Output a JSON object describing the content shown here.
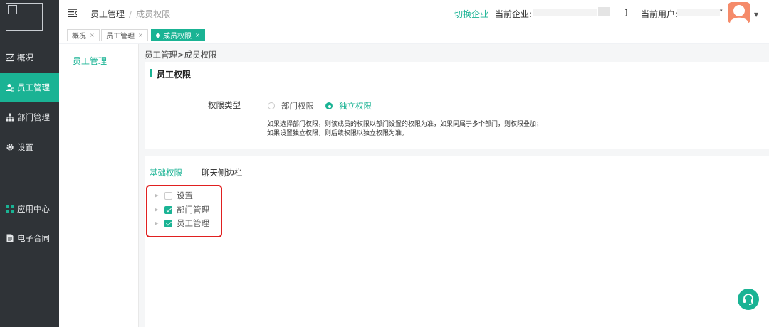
{
  "sidebar": {
    "items": [
      {
        "label": "概况",
        "icon": "chart-icon"
      },
      {
        "label": "员工管理",
        "icon": "users-icon"
      },
      {
        "label": "部门管理",
        "icon": "org-chart-icon"
      },
      {
        "label": "设置",
        "icon": "gear-icon"
      },
      {
        "label": "应用中心",
        "icon": "grid-icon"
      },
      {
        "label": "电子合同",
        "icon": "document-icon"
      }
    ],
    "active_index": 1
  },
  "header": {
    "breadcrumb": [
      "员工管理",
      "成员权限"
    ],
    "breadcrumb_sep": "/",
    "switch_company": "切换企业",
    "current_company_label": "当前企业:",
    "current_company_tail": "]",
    "current_user_label": "当前用户:"
  },
  "tabs": [
    {
      "label": "概况",
      "close": "×",
      "active": false
    },
    {
      "label": "员工管理",
      "close": "×",
      "active": false
    },
    {
      "label": "成员权限",
      "close": "×",
      "active": true
    }
  ],
  "submenu": {
    "item": "员工管理"
  },
  "page": {
    "breadcrumb": "员工管理>成员权限",
    "section_title": "员工权限",
    "permission_type_label": "权限类型",
    "radios": [
      {
        "label": "部门权限",
        "checked": false
      },
      {
        "label": "独立权限",
        "checked": true
      }
    ],
    "hint": "如果选择部门权限，则该成员的权限以部门设置的权限为准，如果同属于多个部门，则权限叠加；如果设置独立权限，则后续权限以独立权限为准。",
    "sub_tabs": [
      {
        "label": "基础权限",
        "active": true
      },
      {
        "label": "聊天侧边栏",
        "active": false
      }
    ],
    "tree": [
      {
        "label": "设置",
        "checked": false
      },
      {
        "label": "部门管理",
        "checked": true
      },
      {
        "label": "员工管理",
        "checked": true
      }
    ]
  },
  "colors": {
    "accent": "#1ab394",
    "sidebar_bg": "#2f3337",
    "highlight": "#e02020"
  }
}
